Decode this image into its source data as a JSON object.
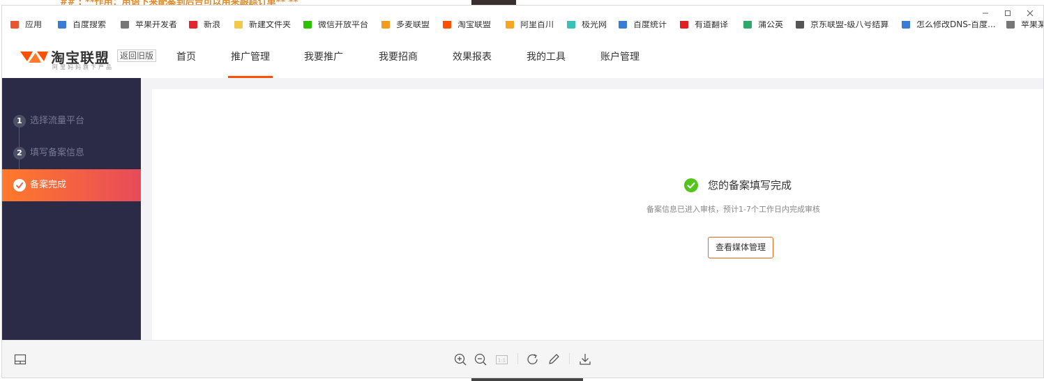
{
  "background": {
    "article_snippet": "## :  **作用：用语下来配案到后台可以用来跟踪订单**   **"
  },
  "bookmarks": [
    {
      "label": "应用",
      "color": "#e8552e"
    },
    {
      "label": "百度搜索",
      "color": "#3a7bd5"
    },
    {
      "label": "苹果开发者",
      "color": "#777777"
    },
    {
      "label": "新浪",
      "color": "#e0262f"
    },
    {
      "label": "新建文件夹",
      "color": "#f2c94c"
    },
    {
      "label": "微信开放平台",
      "color": "#2dc100"
    },
    {
      "label": "多麦联盟",
      "color": "#f29b1d"
    },
    {
      "label": "淘宝联盟",
      "color": "#ff5000"
    },
    {
      "label": "阿里百川",
      "color": "#f5a623"
    },
    {
      "label": "极光网",
      "color": "#3ac1b5"
    },
    {
      "label": "百度统计",
      "color": "#3a7bd5"
    },
    {
      "label": "有道翻译",
      "color": "#e02020"
    },
    {
      "label": "蒲公英",
      "color": "#2fa86a"
    },
    {
      "label": "京东联盟-级八号结算",
      "color": "#555555"
    },
    {
      "label": "怎么修改DNS-百度...",
      "color": "#3a7bd5"
    },
    {
      "label": "苹果某",
      "color": "#777777"
    }
  ],
  "header": {
    "logo_title": "淘宝联盟",
    "logo_subtitle": "阿里妈妈旗下产品",
    "old_version_label": "返回旧版",
    "nav": [
      {
        "label": "首页"
      },
      {
        "label": "推广管理",
        "active": true
      },
      {
        "label": "我要推广"
      },
      {
        "label": "我要招商"
      },
      {
        "label": "效果报表"
      },
      {
        "label": "我的工具"
      },
      {
        "label": "账户管理"
      }
    ]
  },
  "sidebar": {
    "steps": [
      {
        "num": "1",
        "label": "选择流量平台",
        "state": "done"
      },
      {
        "num": "2",
        "label": "填写备案信息",
        "state": "done"
      },
      {
        "num": "3",
        "label": "备案完成",
        "state": "active"
      }
    ]
  },
  "main": {
    "success_title": "您的备案填写完成",
    "success_desc": "备案信息已进入审核，预计1-7个工作日内完成审核",
    "media_button_label": "查看媒体管理"
  },
  "toolbar": {
    "actual_size_label": "1:1"
  },
  "colors": {
    "brand_orange": "#ff5000",
    "sidebar_bg": "#2b2b47",
    "success_green": "#52c41a",
    "button_border": "#e0671f"
  }
}
